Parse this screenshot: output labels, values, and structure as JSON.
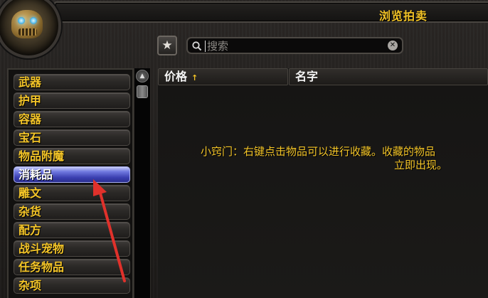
{
  "window": {
    "title": "浏览拍卖"
  },
  "search": {
    "placeholder": "搜索",
    "value": ""
  },
  "icons": {
    "favorites": "star-icon",
    "search": "search-icon",
    "clear": "close-icon",
    "scroll_up": "chevron-up-icon",
    "sort": "sort-ascending-icon",
    "portrait": "character-portrait"
  },
  "categories": [
    {
      "label": "武器",
      "selected": false
    },
    {
      "label": "护甲",
      "selected": false
    },
    {
      "label": "容器",
      "selected": false
    },
    {
      "label": "宝石",
      "selected": false
    },
    {
      "label": "物品附魔",
      "selected": false
    },
    {
      "label": "消耗品",
      "selected": true
    },
    {
      "label": "雕文",
      "selected": false
    },
    {
      "label": "杂货",
      "selected": false
    },
    {
      "label": "配方",
      "selected": false
    },
    {
      "label": "战斗宠物",
      "selected": false
    },
    {
      "label": "任务物品",
      "selected": false
    },
    {
      "label": "杂项",
      "selected": false
    }
  ],
  "results": {
    "columns": [
      "价格",
      "名字"
    ],
    "sort_indicator": "↑",
    "tip_line1": "小窍门：右键点击物品可以进行收藏。收藏的物品",
    "tip_line2": "立即出现。"
  },
  "colors": {
    "accent_gold": "#f4c528",
    "selected_blue": "#3a3fb0",
    "annotation_red": "#e0312b"
  }
}
